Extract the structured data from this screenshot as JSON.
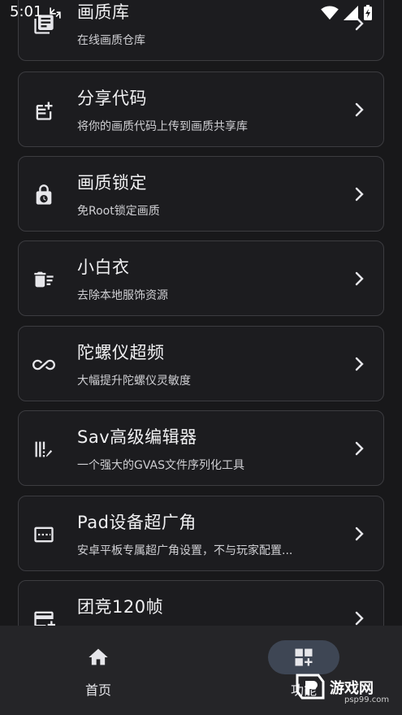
{
  "status": {
    "time": "5:01"
  },
  "cards": [
    {
      "title": "画质库",
      "subtitle": "在线画质仓库",
      "icon": "library-icon"
    },
    {
      "title": "分享代码",
      "subtitle": "将你的画质代码上传到画质共享库",
      "icon": "share-code-icon"
    },
    {
      "title": "画质锁定",
      "subtitle": "免Root锁定画质",
      "icon": "lock-clock-icon"
    },
    {
      "title": "小白衣",
      "subtitle": "去除本地服饰资源",
      "icon": "delete-sweep-icon"
    },
    {
      "title": "陀螺仪超频",
      "subtitle": "大幅提升陀螺仪灵敏度",
      "icon": "infinity-icon"
    },
    {
      "title": "Sav高级编辑器",
      "subtitle": "一个强大的GVAS文件序列化工具",
      "icon": "edit-bars-icon"
    },
    {
      "title": "Pad设备超广角",
      "subtitle": "安卓平板专属超广角设置，不与玩家配置...",
      "icon": "widescreen-icon"
    },
    {
      "title": "团竞120帧",
      "subtitle": "",
      "icon": "card-add-icon"
    }
  ],
  "nav": {
    "home_label": "首页",
    "features_label": "功能"
  },
  "watermark": {
    "text": "游戏网",
    "url": "psp99.com"
  },
  "colors": {
    "background": "#18181a",
    "card_border": "#3c3c40",
    "nav_bg": "#252528",
    "active_pill": "#3e4654"
  }
}
